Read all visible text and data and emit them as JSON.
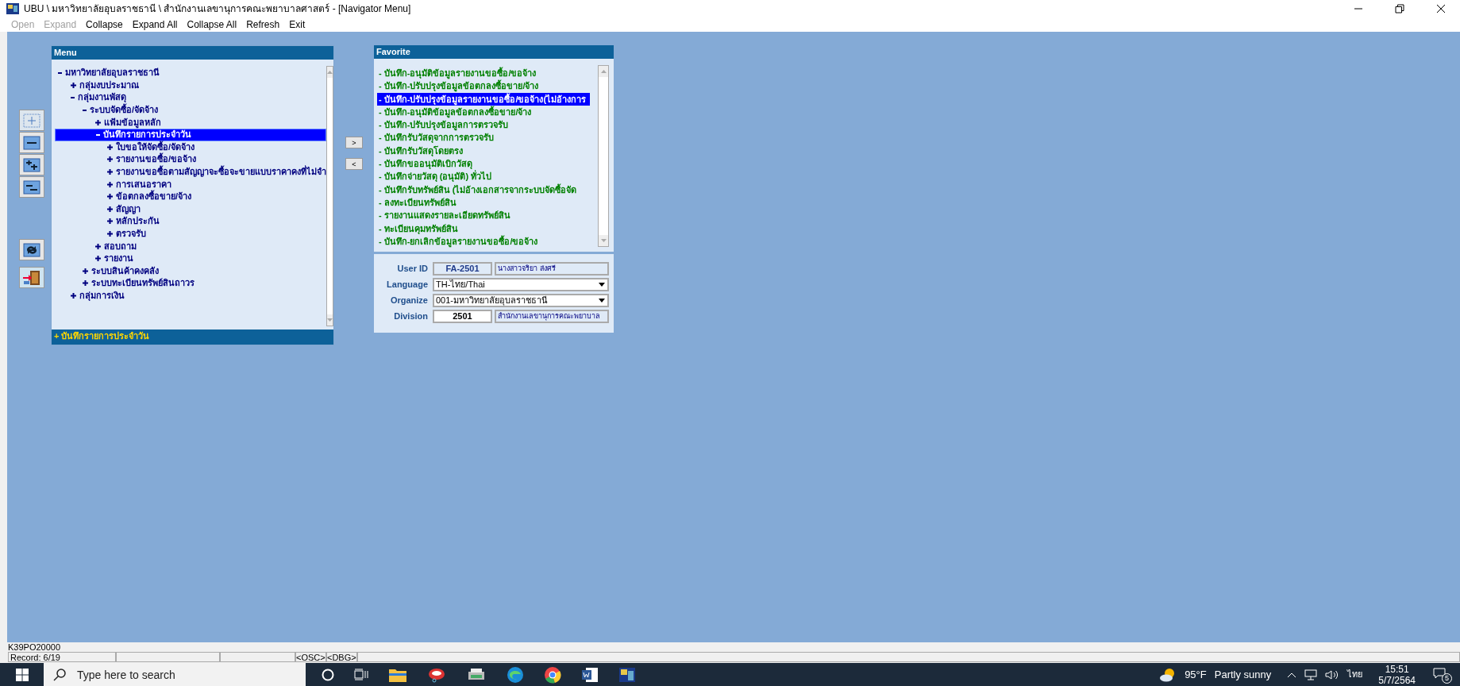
{
  "window": {
    "title": "UBU \\ มหาวิทยาลัยอุบลราชธานี \\ สำนักงานเลขานุการคณะพยาบาลศาสตร์ - [Navigator Menu]"
  },
  "menu_bar": [
    {
      "label": "Open",
      "disabled": true
    },
    {
      "label": "Expand",
      "disabled": true
    },
    {
      "label": "Collapse",
      "disabled": false
    },
    {
      "label": "Expand All",
      "disabled": false
    },
    {
      "label": "Collapse All",
      "disabled": false
    },
    {
      "label": "Refresh",
      "disabled": false
    },
    {
      "label": "Exit",
      "disabled": false
    }
  ],
  "menu_panel": {
    "title": "Menu",
    "tree": [
      {
        "label": "มหาวิทยาลัยอุบลราชธานี",
        "expanded": true,
        "selected": false,
        "children": [
          {
            "label": "กลุ่มงบประมาณ",
            "expanded": false,
            "selected": false
          },
          {
            "label": "กลุ่มงานพัสดุ",
            "expanded": true,
            "selected": false,
            "children": [
              {
                "label": "ระบบจัดซื้อ/จัดจ้าง",
                "expanded": true,
                "selected": false,
                "children": [
                  {
                    "label": "แฟ้มข้อมูลหลัก",
                    "expanded": false,
                    "selected": false
                  },
                  {
                    "label": "บันทึกรายการประจำวัน",
                    "expanded": true,
                    "selected": true,
                    "children": [
                      {
                        "label": "ใบขอให้จัดซื้อ/จัดจ้าง",
                        "expanded": false,
                        "selected": false
                      },
                      {
                        "label": "รายงานขอซื้อ/ขอจ้าง",
                        "expanded": false,
                        "selected": false
                      },
                      {
                        "label": "รายงานขอซื้อตามสัญญาจะซื้อจะขายแบบราคาคงที่ไม่จำ",
                        "expanded": false,
                        "selected": false
                      },
                      {
                        "label": "การเสนอราคา",
                        "expanded": false,
                        "selected": false
                      },
                      {
                        "label": "ข้อตกลงซื้อขาย/จ้าง",
                        "expanded": false,
                        "selected": false
                      },
                      {
                        "label": "สัญญา",
                        "expanded": false,
                        "selected": false
                      },
                      {
                        "label": "หลักประกัน",
                        "expanded": false,
                        "selected": false
                      },
                      {
                        "label": "ตรวจรับ",
                        "expanded": false,
                        "selected": false
                      }
                    ]
                  },
                  {
                    "label": "สอบถาม",
                    "expanded": false,
                    "selected": false
                  },
                  {
                    "label": "รายงาน",
                    "expanded": false,
                    "selected": false
                  }
                ]
              },
              {
                "label": "ระบบสินค้าคงคลัง",
                "expanded": false,
                "selected": false
              },
              {
                "label": "ระบบทะเบียนทรัพย์สินถาวร",
                "expanded": false,
                "selected": false
              }
            ]
          },
          {
            "label": "กลุ่มการเงิน",
            "expanded": false,
            "selected": false
          }
        ]
      }
    ],
    "footer": "+ บันทึกรายการประจำวัน"
  },
  "move_buttons": [
    ">",
    "<"
  ],
  "favorite_panel": {
    "title": "Favorite",
    "items": [
      {
        "label": "- บันทึก-อนุมัติข้อมูลรายงานขอซื้อ/ขอจ้าง",
        "selected": false
      },
      {
        "label": "- บันทึก-ปรับปรุงข้อมูลข้อตกลงซื้อขาย/จ้าง",
        "selected": false
      },
      {
        "label": "- บันทึก-ปรับปรุงข้อมูลรายงานขอซื้อ/ขอจ้าง(ไม่อ้างการ",
        "selected": true
      },
      {
        "label": "- บันทึก-อนุมัติข้อมูลข้อตกลงซื้อขาย/จ้าง",
        "selected": false
      },
      {
        "label": "- บันทึก-ปรับปรุงข้อมูลการตรวจรับ",
        "selected": false
      },
      {
        "label": "- บันทึกรับวัสดุจากการตรวจรับ",
        "selected": false
      },
      {
        "label": "- บันทึกรับวัสดุโดยตรง",
        "selected": false
      },
      {
        "label": "- บันทึกขออนุมัติเบิกวัสดุ",
        "selected": false
      },
      {
        "label": "- บันทึกจ่ายวัสดุ (อนุมัติ) ทั่วไป",
        "selected": false
      },
      {
        "label": "- บันทึกรับทรัพย์สิน (ไม่อ้างเอกสารจากระบบจัดซื้อจัด",
        "selected": false
      },
      {
        "label": "- ลงทะเบียนทรัพย์สิน",
        "selected": false
      },
      {
        "label": "- รายงานแสดงรายละเอียดทรัพย์สิน",
        "selected": false
      },
      {
        "label": "- ทะเบียนคุมทรัพย์สิน",
        "selected": false
      },
      {
        "label": "- บันทึก-ยกเลิกข้อมูลรายงานขอซื้อ/ขอจ้าง",
        "selected": false
      }
    ]
  },
  "user_form": {
    "user_id_label": "User ID",
    "user_id": "FA-2501",
    "user_name": "นางสาวจริยา ส่งศรี",
    "language_label": "Language",
    "language": "TH-ไทย/Thai",
    "organize_label": "Organize",
    "organize": "001-มหาวิทยาลัยอุบลราชธานี",
    "division_label": "Division",
    "division": "2501",
    "division_name": "สำนักงานเลขานุการคณะพยาบาล"
  },
  "status_bar": {
    "form_code": "K39PO20000",
    "record": "Record: 6/19",
    "osc": "<OSC>",
    "dbg": "<DBG>"
  },
  "taskbar": {
    "search_placeholder": "Type here to search",
    "temperature": "95°F",
    "weather": "Partly sunny",
    "input_language": "ไทย",
    "time": "15:51",
    "date": "5/7/2564",
    "notifications": "5"
  }
}
